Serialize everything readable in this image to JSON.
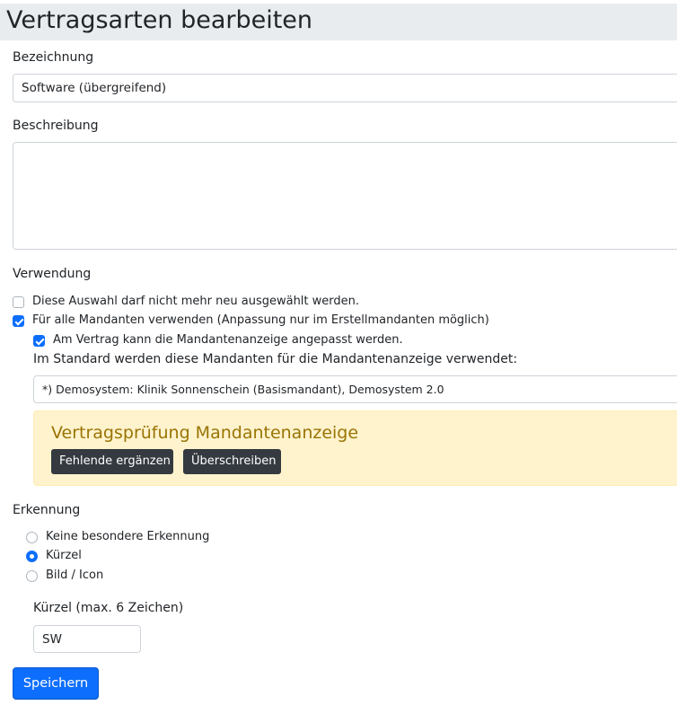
{
  "page": {
    "title": "Vertragsarten bearbeiten"
  },
  "form": {
    "name_label": "Bezeichnung",
    "name_value": "Software (übergreifend)",
    "description_label": "Beschreibung",
    "description_value": "",
    "usage_label": "Verwendung",
    "usage_options": [
      {
        "label": "Diese Auswahl darf nicht mehr neu ausgewählt werden.",
        "checked": false
      },
      {
        "label": "Für alle Mandanten verwenden (Anpassung nur im Erstellmandanten möglich)",
        "checked": true
      },
      {
        "label": "Am Vertrag kann die Mandantenanzeige angepasst werden.",
        "checked": true
      }
    ],
    "default_clients_label": "Im Standard werden diese Mandanten für die Mandantenanzeige verwendet:",
    "default_clients_value": "*) Demosystem: Klinik Sonnenschein (Basismandant), Demosystem 2.0",
    "check_panel": {
      "title": "Vertragsprüfung Mandantenanzeige",
      "fill_missing_label": "Fehlende ergänzen",
      "overwrite_label": "Überschreiben"
    },
    "recognition_label": "Erkennung",
    "recognition_options": [
      {
        "label": "Keine besondere Erkennung",
        "checked": false
      },
      {
        "label": "Kürzel",
        "checked": true
      },
      {
        "label": "Bild / Icon",
        "checked": false
      }
    ],
    "abbreviation_label": "Kürzel (max. 6 Zeichen)",
    "abbreviation_value": "SW",
    "save_label": "Speichern"
  },
  "colors": {
    "primary": "#0d6efd",
    "header_bg": "#e9ecef",
    "alert_bg": "#fff3cd",
    "alert_text": "#997404",
    "dark_button": "#343a40"
  }
}
